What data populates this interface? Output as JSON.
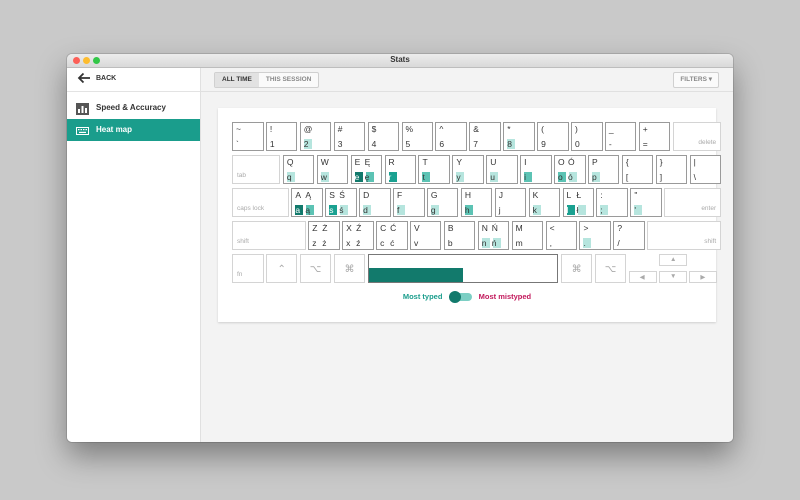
{
  "window": {
    "title": "Stats"
  },
  "sidebar": {
    "back_label": "BACK",
    "items": [
      {
        "label": "Speed & Accuracy",
        "icon": "bar-chart-icon",
        "active": false
      },
      {
        "label": "Heat map",
        "icon": "keyboard-icon",
        "active": true
      }
    ]
  },
  "tabs": [
    {
      "label": "ALL TIME",
      "active": true
    },
    {
      "label": "THIS SESSION",
      "active": false
    }
  ],
  "filters_label": "FILTERS",
  "legend": {
    "left": "Most typed",
    "right": "Most mistyped"
  },
  "colors": {
    "accent": "#1a9d8c",
    "level1": "#b6e5de",
    "level2": "#5cc3b4",
    "level3": "#1aa191",
    "level4": "#127a6c",
    "mistyped": "#c2185b"
  },
  "keyboard": {
    "rows": [
      [
        {
          "t": "~",
          "b": "`"
        },
        {
          "t": "!",
          "b": "1"
        },
        {
          "t": "@",
          "b": "2",
          "h": 1
        },
        {
          "t": "#",
          "b": "3"
        },
        {
          "t": "$",
          "b": "4"
        },
        {
          "t": "%",
          "b": "5"
        },
        {
          "t": "^",
          "b": "6"
        },
        {
          "t": "&",
          "b": "7"
        },
        {
          "t": "*",
          "b": "8",
          "h": 1
        },
        {
          "t": "(",
          "b": "9"
        },
        {
          "t": ")",
          "b": "0"
        },
        {
          "t": "_",
          "b": "-"
        },
        {
          "t": "+",
          "b": "="
        },
        {
          "label": "delete",
          "w": 1.5,
          "light": true
        }
      ],
      [
        {
          "label": "tab",
          "w": 1.5,
          "light": true
        },
        {
          "t": "Q",
          "b": "q",
          "h": 1
        },
        {
          "t": "W",
          "b": "w",
          "h": 1
        },
        {
          "t": "E",
          "b": "e",
          "h": 4,
          "t2": "Ę",
          "b2": "ę"
        },
        {
          "t": "R",
          "b": "r",
          "h": 3
        },
        {
          "t": "T",
          "b": "t",
          "h": 2
        },
        {
          "t": "Y",
          "b": "y",
          "h": 1
        },
        {
          "t": "U",
          "b": "u",
          "h": 1
        },
        {
          "t": "I",
          "b": "i",
          "h": 2
        },
        {
          "t": "O",
          "b": "o",
          "h": 2,
          "t2": "Ó",
          "b2": "ó"
        },
        {
          "t": "P",
          "b": "p",
          "h": 1
        },
        {
          "t": "{",
          "b": "["
        },
        {
          "t": "}",
          "b": "]"
        },
        {
          "t": "|",
          "b": "\\"
        }
      ],
      [
        {
          "label": "caps lock",
          "w": 1.75,
          "light": true
        },
        {
          "t": "A",
          "b": "a",
          "h": 4,
          "t2": "Ą",
          "b2": "ą"
        },
        {
          "t": "S",
          "b": "s",
          "h": 3,
          "t2": "Ś",
          "b2": "ś"
        },
        {
          "t": "D",
          "b": "d",
          "h": 1
        },
        {
          "t": "F",
          "b": "f",
          "h": 1
        },
        {
          "t": "G",
          "b": "g",
          "h": 1
        },
        {
          "t": "H",
          "b": "h",
          "h": 2
        },
        {
          "t": "J",
          "b": "j"
        },
        {
          "t": "K",
          "b": "k",
          "h": 1
        },
        {
          "t": "L",
          "b": "l",
          "h": 3,
          "t2": "Ł",
          "b2": "ł"
        },
        {
          "t": ":",
          "b": ";",
          "h": 1
        },
        {
          "t": "\"",
          "b": "'",
          "h": 1
        },
        {
          "label": "enter",
          "w": 1.75,
          "light": true
        }
      ],
      [
        {
          "label": "shift",
          "w": 2.25,
          "light": true
        },
        {
          "t": "Z",
          "b": "z",
          "t2": "Ż",
          "b2": "ż"
        },
        {
          "t": "X",
          "b": "x",
          "t2": "Ź",
          "b2": "ź"
        },
        {
          "t": "C",
          "b": "c",
          "t2": "Ć",
          "b2": "ć"
        },
        {
          "t": "V",
          "b": "v"
        },
        {
          "t": "B",
          "b": "b"
        },
        {
          "t": "N",
          "b": "n",
          "h": 1,
          "t2": "Ń",
          "b2": "ń"
        },
        {
          "t": "M",
          "b": "m"
        },
        {
          "t": "<",
          "b": ","
        },
        {
          "t": ">",
          "b": ".",
          "h": 1
        },
        {
          "t": "?",
          "b": "/"
        },
        {
          "label": "shift",
          "w": 2.25,
          "light": true
        }
      ],
      [
        {
          "label": "fn",
          "light": true
        },
        {
          "label": "⌃",
          "light": true,
          "center": true
        },
        {
          "label": "⌥",
          "light": true,
          "center": true
        },
        {
          "label": "⌘",
          "light": true,
          "center": true
        },
        {
          "space": true,
          "w": 5.7,
          "fill": 0.5
        },
        {
          "label": "⌘",
          "light": true,
          "center": true
        },
        {
          "label": "⌥",
          "light": true,
          "center": true
        },
        {
          "arrows": true
        }
      ]
    ]
  }
}
